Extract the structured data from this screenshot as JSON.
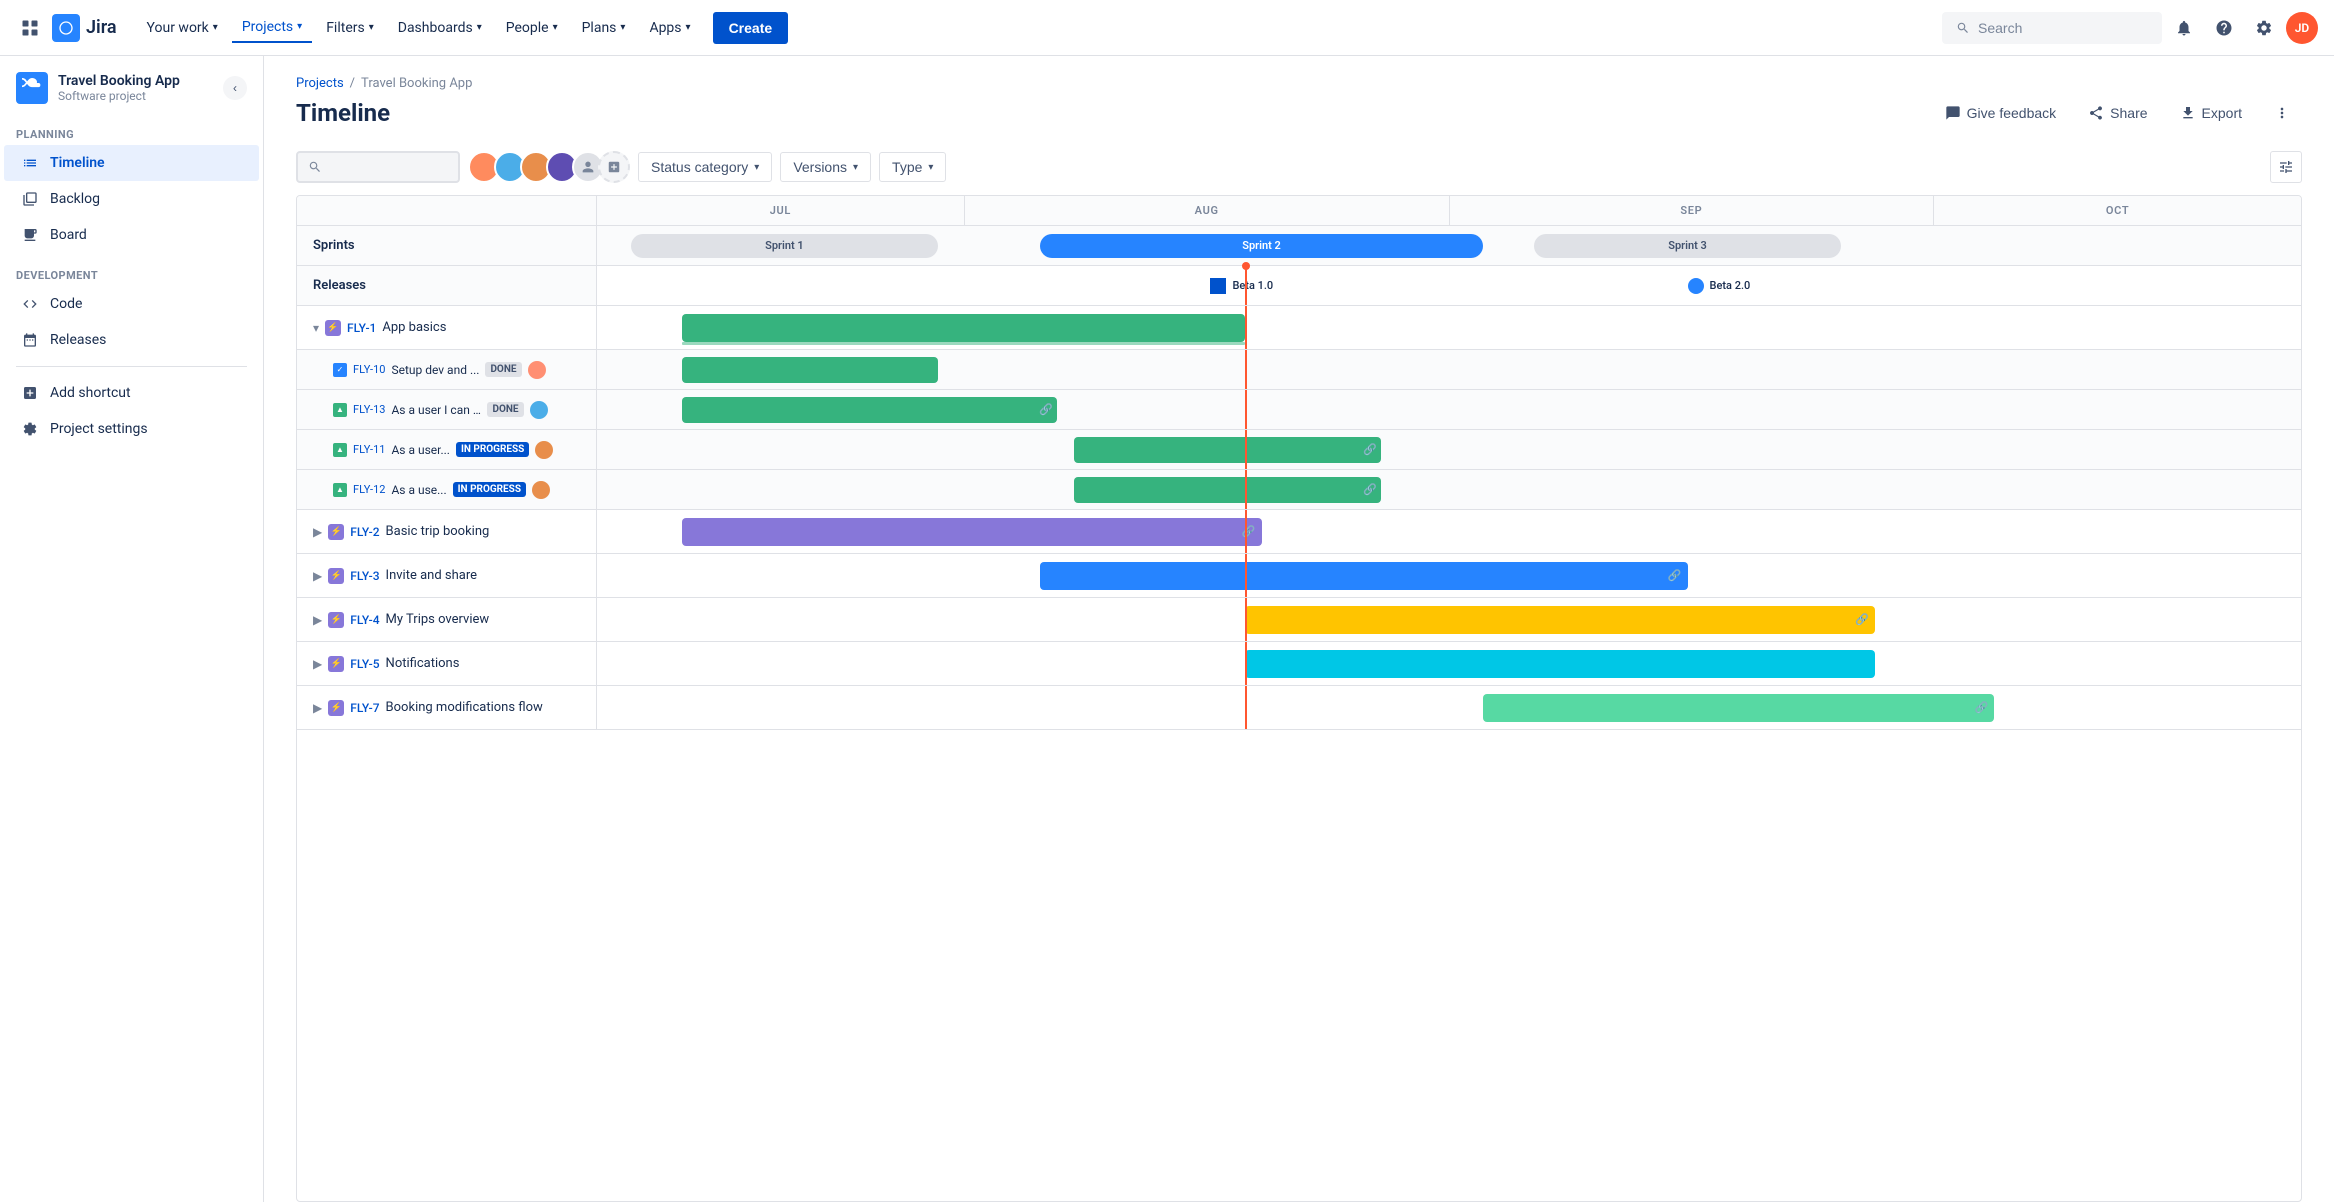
{
  "topnav": {
    "logo_text": "Jira",
    "items": [
      {
        "label": "Your work",
        "has_chevron": true
      },
      {
        "label": "Projects",
        "has_chevron": true,
        "active": true
      },
      {
        "label": "Filters",
        "has_chevron": true
      },
      {
        "label": "Dashboards",
        "has_chevron": true
      },
      {
        "label": "People",
        "has_chevron": true
      },
      {
        "label": "Plans",
        "has_chevron": true
      },
      {
        "label": "Apps",
        "has_chevron": true
      }
    ],
    "create_label": "Create",
    "search_placeholder": "Search"
  },
  "sidebar": {
    "project_name": "Travel Booking App",
    "project_type": "Software project",
    "sections": [
      {
        "label": "PLANNING",
        "items": [
          {
            "label": "Timeline",
            "active": true,
            "icon": "timeline"
          },
          {
            "label": "Backlog",
            "icon": "backlog"
          },
          {
            "label": "Board",
            "icon": "board"
          }
        ]
      },
      {
        "label": "DEVELOPMENT",
        "items": [
          {
            "label": "Code",
            "icon": "code"
          },
          {
            "label": "Releases",
            "icon": "releases"
          }
        ]
      }
    ],
    "bottom_items": [
      {
        "label": "Add shortcut",
        "icon": "add"
      },
      {
        "label": "Project settings",
        "icon": "settings"
      }
    ]
  },
  "breadcrumb": {
    "parts": [
      "Projects",
      "Travel Booking App"
    ]
  },
  "page_title": "Timeline",
  "page_actions": {
    "feedback_label": "Give feedback",
    "share_label": "Share",
    "export_label": "Export"
  },
  "toolbar": {
    "status_category_label": "Status category",
    "versions_label": "Versions",
    "type_label": "Type"
  },
  "timeline": {
    "months": [
      "JUL",
      "AUG",
      "SEP",
      "OCT"
    ],
    "sprints_label": "Sprints",
    "releases_label": "Releases",
    "sprint_bars": [
      {
        "label": "Sprint 1",
        "style": "gray",
        "left_pct": 2,
        "width_pct": 18
      },
      {
        "label": "Sprint 2",
        "style": "blue",
        "left_pct": 21,
        "width_pct": 28
      },
      {
        "label": "Sprint 3",
        "style": "gray",
        "left_pct": 50,
        "width_pct": 18
      }
    ],
    "releases": [
      {
        "label": "Beta 1.0",
        "left_pct": 32
      },
      {
        "label": "Beta 2.0",
        "left_pct": 65
      }
    ],
    "epics": [
      {
        "id": "FLY-1",
        "name": "App basics",
        "expanded": true,
        "bar_color": "#36B37E",
        "bar_left_pct": 5,
        "bar_width_pct": 34,
        "underline_color": "#36B37E",
        "subtasks": [
          {
            "id": "FLY-10",
            "name": "Setup dev and ...",
            "status": "DONE",
            "bar_color": "#36B37E",
            "bar_left_pct": 5,
            "bar_width_pct": 15,
            "avatar": 1
          },
          {
            "id": "FLY-13",
            "name": "As a user I can ...",
            "status": "DONE",
            "bar_color": "#36B37E",
            "bar_left_pct": 5,
            "bar_width_pct": 21,
            "has_link": true,
            "avatar": 2
          },
          {
            "id": "FLY-11",
            "name": "As a user...",
            "status": "IN PROGRESS",
            "bar_color": "#36B37E",
            "bar_left_pct": 22,
            "bar_width_pct": 16,
            "has_link": true,
            "avatar": 3
          },
          {
            "id": "FLY-12",
            "name": "As a use...",
            "status": "IN PROGRESS",
            "bar_color": "#36B37E",
            "bar_left_pct": 22,
            "bar_width_pct": 16,
            "has_link": true,
            "avatar": 3
          }
        ]
      },
      {
        "id": "FLY-2",
        "name": "Basic trip booking",
        "expanded": false,
        "bar_color": "#8777D9",
        "bar_left_pct": 5,
        "bar_width_pct": 34,
        "has_link": true
      },
      {
        "id": "FLY-3",
        "name": "Invite and share",
        "expanded": false,
        "bar_color": "#2684FF",
        "bar_left_pct": 22,
        "bar_width_pct": 36,
        "has_link": true
      },
      {
        "id": "FLY-4",
        "name": "My Trips overview",
        "expanded": false,
        "bar_color": "#FFC400",
        "bar_left_pct": 35,
        "bar_width_pct": 36,
        "has_link": true
      },
      {
        "id": "FLY-5",
        "name": "Notifications",
        "expanded": false,
        "bar_color": "#00C7E6",
        "bar_left_pct": 35,
        "bar_width_pct": 36
      },
      {
        "id": "FLY-7",
        "name": "Booking modifications flow",
        "expanded": false,
        "bar_color": "#57D9A3",
        "bar_left_pct": 50,
        "bar_width_pct": 30,
        "has_link": true
      }
    ]
  }
}
